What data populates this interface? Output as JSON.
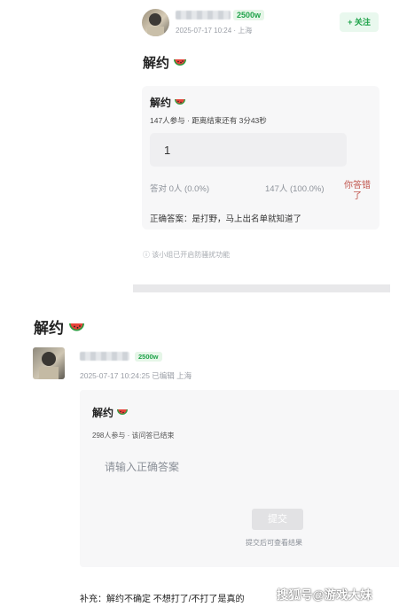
{
  "post_top": {
    "level_badge": "2500w",
    "meta": "2025-07-17 10:24 · 上海",
    "follow_label": "+ 关注",
    "title": "解约",
    "poll": {
      "title": "解约",
      "stats": "147人参与 · 距离结束还有 3分43秒",
      "option_value": "1",
      "correct_label": "答对 0人 (0.0%)",
      "total_label": "147人 (100.0%)",
      "wrong_label_1": "你答错",
      "wrong_label_2": "了",
      "answer_label": "正确答案：是打野，马上出名单就知道了"
    },
    "anti_spam_note": "ⓘ 该小组已开启防骚扰功能"
  },
  "post_bottom": {
    "title": "解约",
    "level_badge": "2500w",
    "meta": "2025-07-17 10:24:25 已编辑 上海",
    "poll": {
      "title": "解约",
      "stats": "298人参与 · 该问答已结束",
      "input_placeholder": "请输入正确答案",
      "submit_label": "提交",
      "submit_hint": "提交后可查看结果"
    },
    "supplement": "补充：解约不确定 不想打了/不打了是真的"
  },
  "watermark": "搜狐号@游戏大妹",
  "colors": {
    "accent_green": "#1fa34a",
    "wrong_red": "#c0534b"
  },
  "icons": [
    "avatar",
    "watermelon-emoji-icon",
    "info-icon"
  ]
}
